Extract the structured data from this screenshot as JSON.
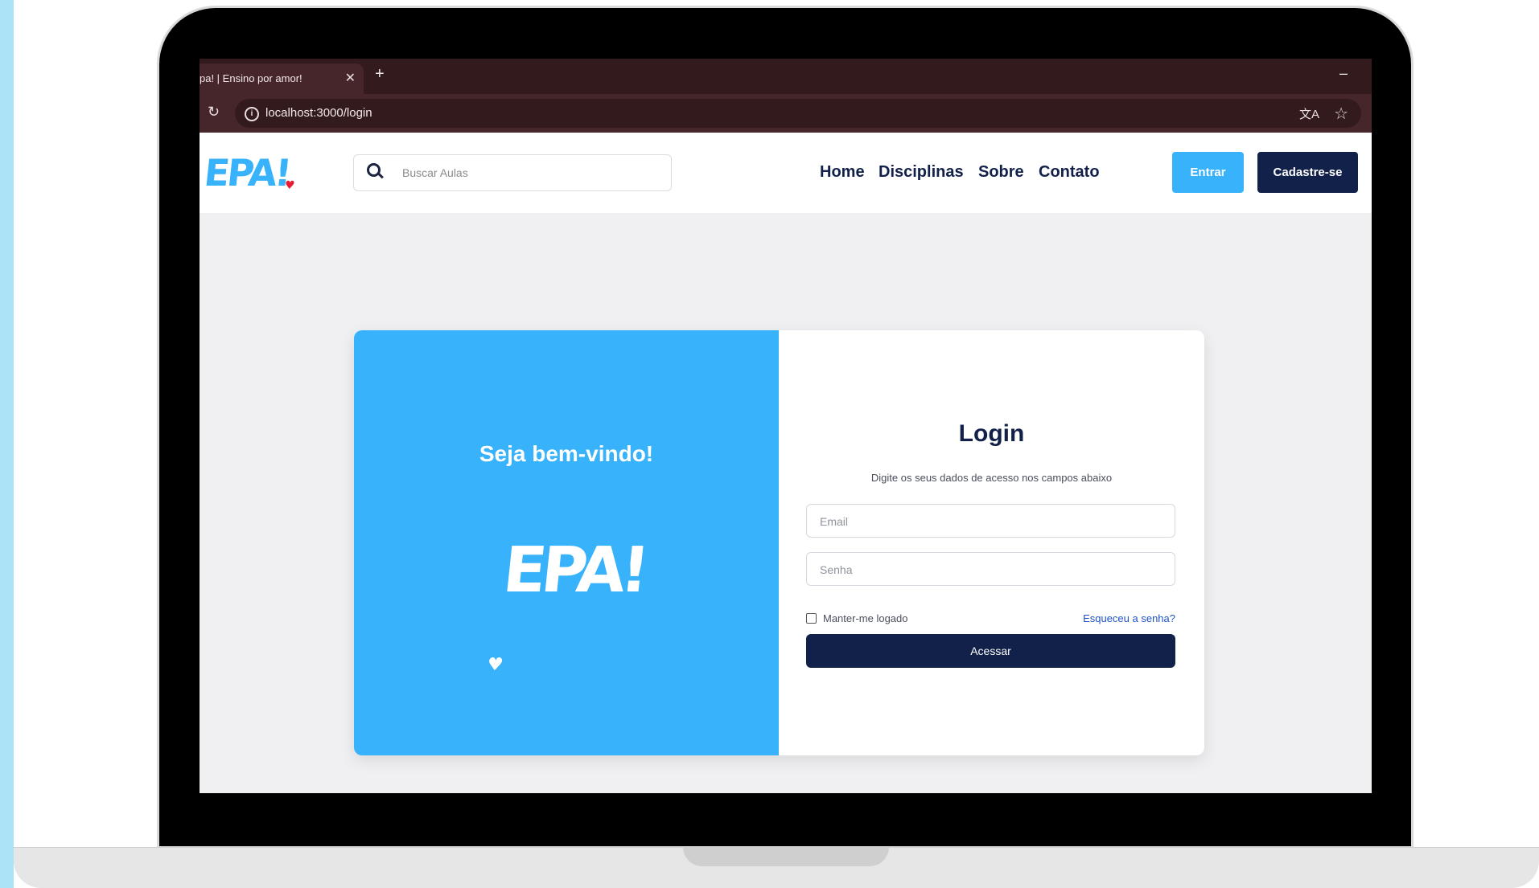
{
  "browser": {
    "tab_title": "pa! | Ensino por amor!",
    "tab_close": "✕",
    "new_tab": "+",
    "minimize": "–",
    "url": "localhost:3000/login"
  },
  "site": {
    "logo_text": "EPA!",
    "logo_heart": "♥",
    "search_placeholder": "Buscar Aulas",
    "nav": [
      "Home",
      "Disciplinas",
      "Sobre",
      "Contato"
    ],
    "login_button": "Entrar",
    "signup_button": "Cadastre-se"
  },
  "card": {
    "welcome": "Seja bem-vindo!",
    "logo_text": "EPA!",
    "title": "Login",
    "subtitle": "Digite os seus dados de acesso nos campos abaixo",
    "email_placeholder": "Email",
    "password_placeholder": "Senha",
    "remember_label": "Manter-me logado",
    "forgot_link": "Esqueceu a senha?",
    "submit": "Acessar"
  },
  "colors": {
    "brand_blue": "#38b2fa",
    "brand_navy": "#12214a",
    "heart_red": "#e81b32",
    "browser_frame": "#331a1c",
    "link_blue": "#1f52c9"
  },
  "icons": [
    "close-icon",
    "plus-icon",
    "reload-icon",
    "info-icon",
    "translate-icon",
    "star-icon",
    "search-icon",
    "checkbox-icon"
  ]
}
